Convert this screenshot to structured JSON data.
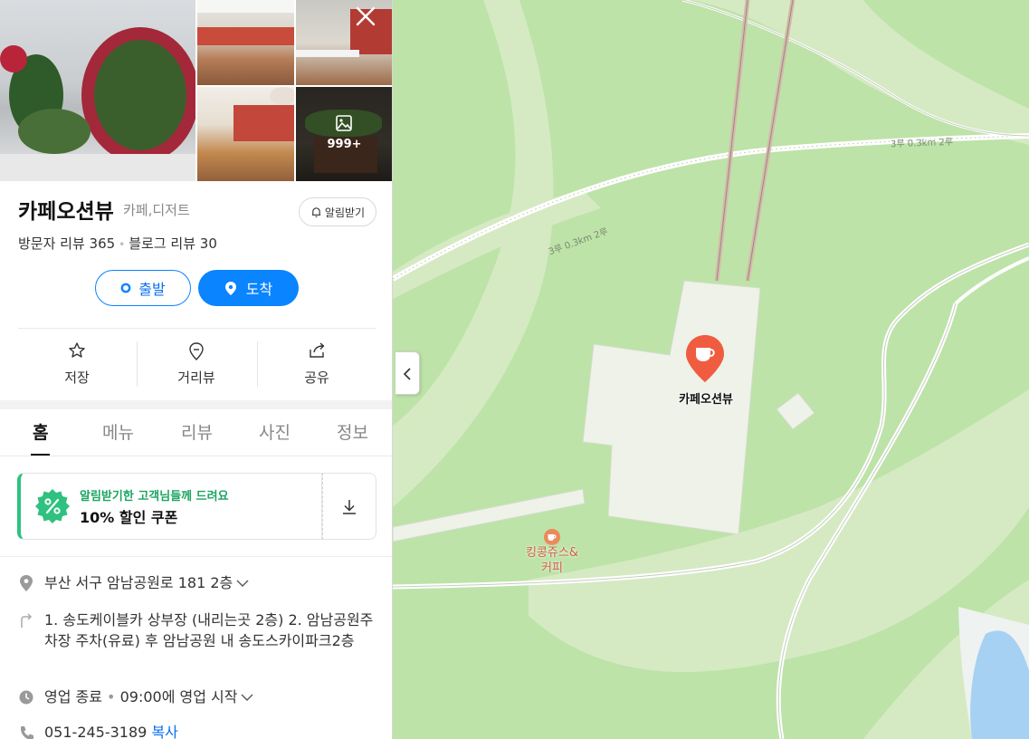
{
  "place": {
    "name": "카페오션뷰",
    "category": "카페,디저트",
    "alarm_label": "알림받기",
    "visitor_review": "방문자 리뷰 365",
    "blog_review": "블로그 리뷰 30",
    "photo_count": "999+"
  },
  "route_buttons": {
    "start": "출발",
    "arrive": "도착"
  },
  "actions": {
    "save": "저장",
    "street_view": "거리뷰",
    "share": "공유"
  },
  "tabs": [
    "홈",
    "메뉴",
    "리뷰",
    "사진",
    "정보"
  ],
  "coupon": {
    "subtitle": "알림받기한 고객님들께 드려요",
    "title": "10% 할인 쿠폰"
  },
  "info": {
    "address": "부산 서구 암남공원로 181 2층",
    "directions": "1. 송도케이블카 상부장 (내리는곳 2층) 2. 암남공원주차장 주차(유료) 후 암남공원 내 송도스카이파크2층",
    "hours_status": "영업 종료",
    "hours_next": "09:00에 영업 시작",
    "phone": "051-245-3189",
    "copy_label": "복사"
  },
  "map": {
    "cafe_label": "카페오션뷰",
    "nearby_label": "킹콩쥬스&\n커피",
    "road_label_1": "3루 0.3km 2루",
    "road_label_2": "3루 0.3km 2루",
    "colors": {
      "park": "#bde3a8",
      "light_park": "#d9ecc8",
      "building": "#edf2e6",
      "water": "#a7d1f2",
      "pin": "#f05c3f"
    }
  }
}
